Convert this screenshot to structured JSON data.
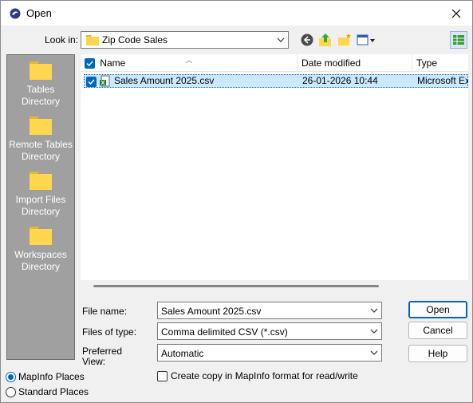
{
  "window": {
    "title": "Open",
    "close_icon": "close-icon"
  },
  "lookin": {
    "label": "Look in:",
    "value": "Zip Code Sales"
  },
  "places": [
    {
      "label": "Tables Directory"
    },
    {
      "label": "Remote Tables Directory"
    },
    {
      "label": "Import Files Directory"
    },
    {
      "label": "Workspaces Directory"
    }
  ],
  "places_mode": {
    "mapinfo": "MapInfo Places",
    "standard": "Standard Places",
    "selected": "mapinfo"
  },
  "list": {
    "columns": [
      "Name",
      "Date modified",
      "Type"
    ],
    "rows": [
      {
        "name": "Sales Amount 2025.csv",
        "date": "26-01-2026 10:44",
        "type": "Microsoft Ex"
      }
    ]
  },
  "fields": {
    "filename_label": "File name:",
    "filename_value": "Sales Amount 2025.csv",
    "filetype_label": "Files of type:",
    "filetype_value": "Comma delimited CSV (*.csv)",
    "view_label_1": "Preferred",
    "view_label_2": "View:",
    "view_value": "Automatic",
    "copy_label": "Create copy in MapInfo format for read/write",
    "copy_checked": false
  },
  "buttons": {
    "open": "Open",
    "cancel": "Cancel",
    "help": "Help"
  },
  "colors": {
    "accent": "#0067c0",
    "places_bg": "#a0a0a0",
    "selection": "#cce8ff",
    "folder": "#ffd64d"
  }
}
